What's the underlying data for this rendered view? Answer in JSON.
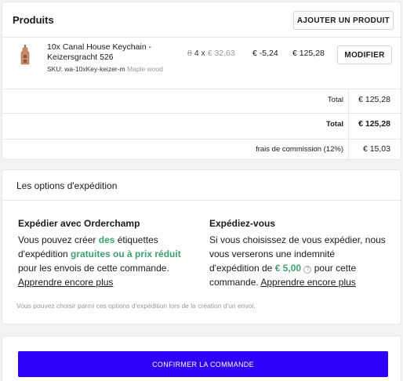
{
  "products": {
    "heading": "Produits",
    "add_button": "AJOUTER UN PRODUIT",
    "item": {
      "title": "10x Canal House Keychain - Keizersgracht 526",
      "sku": "SKU: wa-10xKey-keizer-m",
      "variant": "Maple wood",
      "old_qty": "8",
      "qty_x": "4 x",
      "unit_price": "€ 32,63",
      "discount": "€ -5,24",
      "line_total": "€ 125,28",
      "modify_button": "MODIFIER",
      "thumb_icon": "keychain-thumbnail"
    },
    "subtotal_label": "Total",
    "subtotal_value": "€ 125,28",
    "total_label": "Total",
    "total_value": "€ 125,28",
    "commission_label": "frais de commission (12%)",
    "commission_value": "€ 15,03"
  },
  "shipping": {
    "heading": "Les options d'expédition",
    "orderchamp": {
      "title": "Expédier avec Orderchamp",
      "t1": "Vous pouvez créer ",
      "g1": "des",
      "t2": " étiquettes d'expédition ",
      "g2": "gratuites ou à prix réduit",
      "t3": " pour les envois de cette commande. ",
      "link": "Apprendre encore plus"
    },
    "self": {
      "title": "Expédiez-vous",
      "t1": "Si vous choisissez de vous expédier, nous vous verserons une indemnité d'expédition de ",
      "amount": "€ 5,00",
      "info_icon": "?",
      "t2": " pour cette commande. ",
      "link": "Apprendre encore plus"
    },
    "note": "Vous pouvez choisir parmi ces options d'expédition lors de la création d'un envoi."
  },
  "confirm_button": "CONFIRMER LA COMMANDE",
  "colors": {
    "accent": "#2d00f7",
    "green": "#3fa06f"
  }
}
